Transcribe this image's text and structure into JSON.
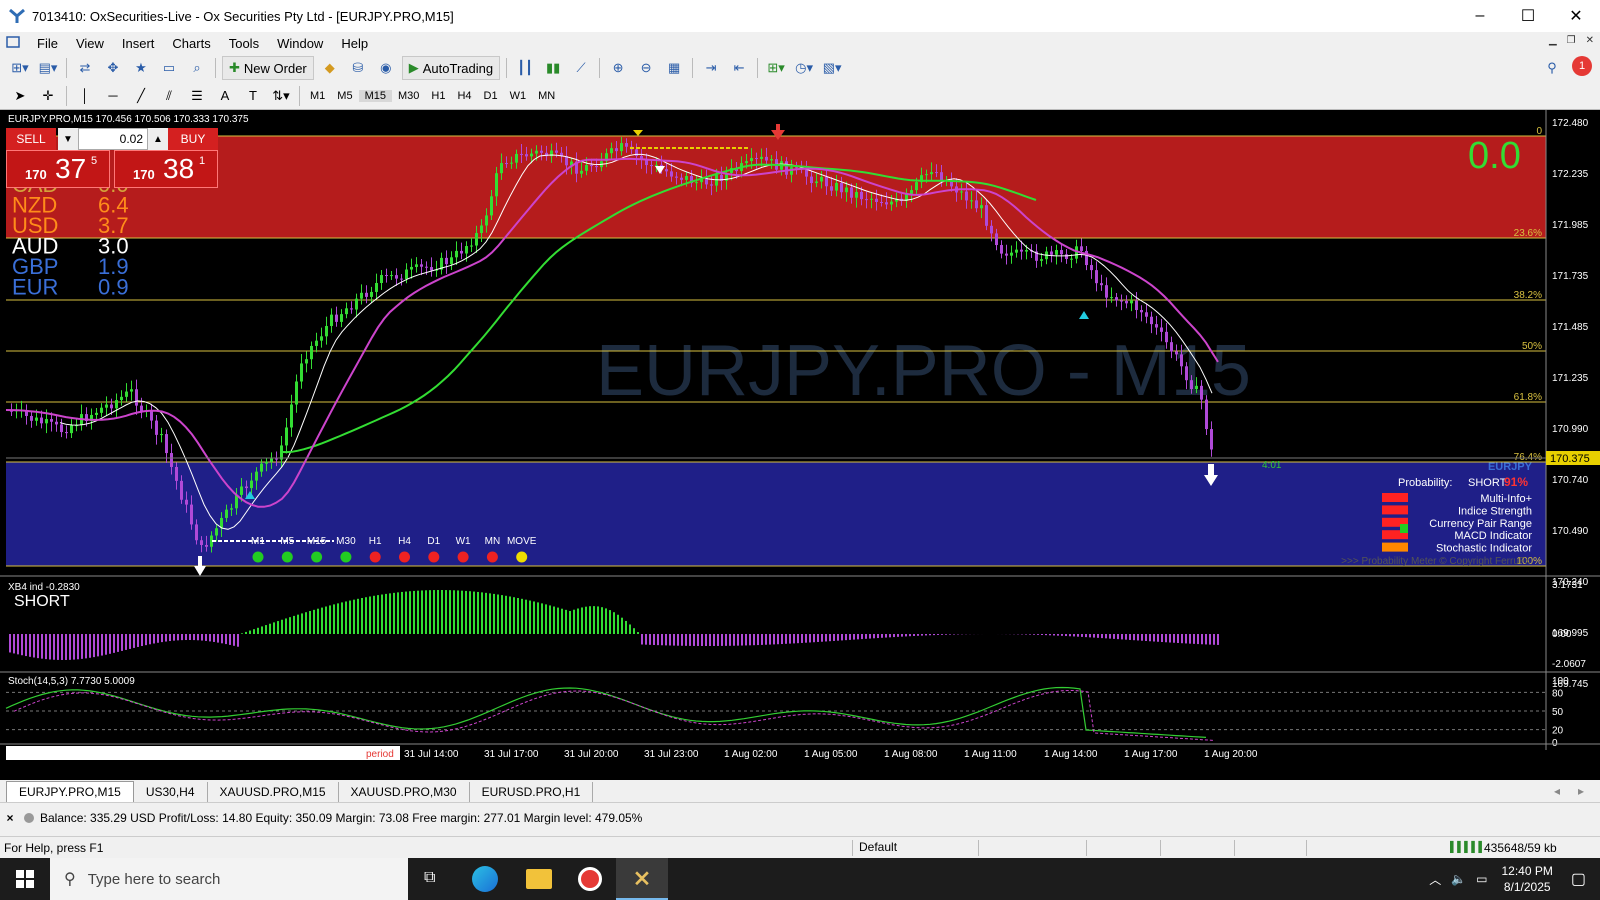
{
  "window": {
    "title": "7013410: OxSecurities-Live - Ox Securities Pty Ltd - [EURJPY.PRO,M15]",
    "minimize": "–",
    "maximize": "☐",
    "close": "✕"
  },
  "menu": [
    "File",
    "View",
    "Insert",
    "Charts",
    "Tools",
    "Window",
    "Help"
  ],
  "toolbar": {
    "new_order": "New Order",
    "autotrading": "AutoTrading",
    "timeframes": [
      "M1",
      "M5",
      "M15",
      "M30",
      "H1",
      "H4",
      "D1",
      "W1",
      "MN"
    ],
    "notification_count": "1"
  },
  "chart": {
    "header": "EURJPY.PRO,M15  170.456 170.506 170.333 170.375",
    "watermark": "EURJPY.PRO - M15",
    "big_value": "0.0",
    "one_click": {
      "sell_label": "SELL",
      "buy_label": "BUY",
      "lot": "0.02",
      "sell_prefix": "170",
      "sell_big": "37",
      "sell_sup": "5",
      "buy_prefix": "170",
      "buy_big": "38",
      "buy_sup": "1"
    },
    "currency_strength": [
      {
        "code": "CAD",
        "value": "0.0",
        "color": "#d4a23a"
      },
      {
        "code": "NZD",
        "value": "6.4",
        "color": "#ff8c1a"
      },
      {
        "code": "USD",
        "value": "3.7",
        "color": "#ff8c1a"
      },
      {
        "code": "AUD",
        "value": "3.0",
        "color": "#ffffff"
      },
      {
        "code": "GBP",
        "value": "1.9",
        "color": "#3a6fd8"
      },
      {
        "code": "EUR",
        "value": "0.9",
        "color": "#3a6fd8"
      }
    ],
    "price_axis": [
      "172.480",
      "172.235",
      "171.985",
      "171.735",
      "171.485",
      "171.235",
      "170.990",
      "170.740",
      "170.490",
      "170.240",
      "169.995",
      "169.745"
    ],
    "current_price": "170.375",
    "fib_levels": [
      "0",
      "23.6%",
      "38.2%",
      "50%",
      "61.8%",
      "76.4%",
      "100%"
    ],
    "timer": "4:01",
    "time_axis": [
      "31 Jul 14:00",
      "31 Jul 17:00",
      "31 Jul 20:00",
      "31 Jul 23:00",
      "1 Aug 02:00",
      "1 Aug 05:00",
      "1 Aug 08:00",
      "1 Aug 11:00",
      "1 Aug 14:00",
      "1 Aug 17:00",
      "1 Aug 20:00"
    ],
    "period_label": "period",
    "mtf": {
      "labels": [
        "M1",
        "M5",
        "M15",
        "M30",
        "H1",
        "H4",
        "D1",
        "W1",
        "MN",
        "MOVE"
      ],
      "colors": [
        "#22cc22",
        "#22cc22",
        "#22cc22",
        "#22cc22",
        "#ee2222",
        "#ee2222",
        "#ee2222",
        "#ee2222",
        "#ee2222",
        "#eedd00"
      ]
    },
    "probability_panel": {
      "symbol": "EURJPY",
      "probability_label": "Probability:",
      "direction": "SHORT",
      "percent": "91%",
      "rows": [
        "Multi-Info+",
        "Indice Strength",
        "Currency Pair Range",
        "MACD Indicator",
        "Stochastic Indicator"
      ],
      "copyright": ">>> Probability Meter © Copyright FerruFx"
    },
    "xb4": {
      "header": "XB4 ind -0.2830",
      "signal": "SHORT",
      "axis": [
        "3.1731",
        "0.00",
        "-2.0607"
      ]
    },
    "stoch": {
      "header": "Stoch(14,5,3) 7.7730 5.0009",
      "axis": [
        "100",
        "80",
        "50",
        "20",
        "0"
      ]
    }
  },
  "tabs": [
    "EURJPY.PRO,M15",
    "US30,H4",
    "XAUUSD.PRO,M15",
    "XAUUSD.PRO,M30",
    "EURUSD.PRO,H1"
  ],
  "terminal": {
    "close": "×",
    "summary": "Balance: 335.29 USD  Profit/Loss: 14.80  Equity: 350.09  Margin: 73.08  Free margin: 277.01  Margin level: 479.05%"
  },
  "status": {
    "help": "For Help, press F1",
    "profile": "Default",
    "traffic": "435648/59 kb"
  },
  "taskbar": {
    "search_placeholder": "Type here to search",
    "time": "12:40 PM",
    "date": "8/1/2025"
  }
}
